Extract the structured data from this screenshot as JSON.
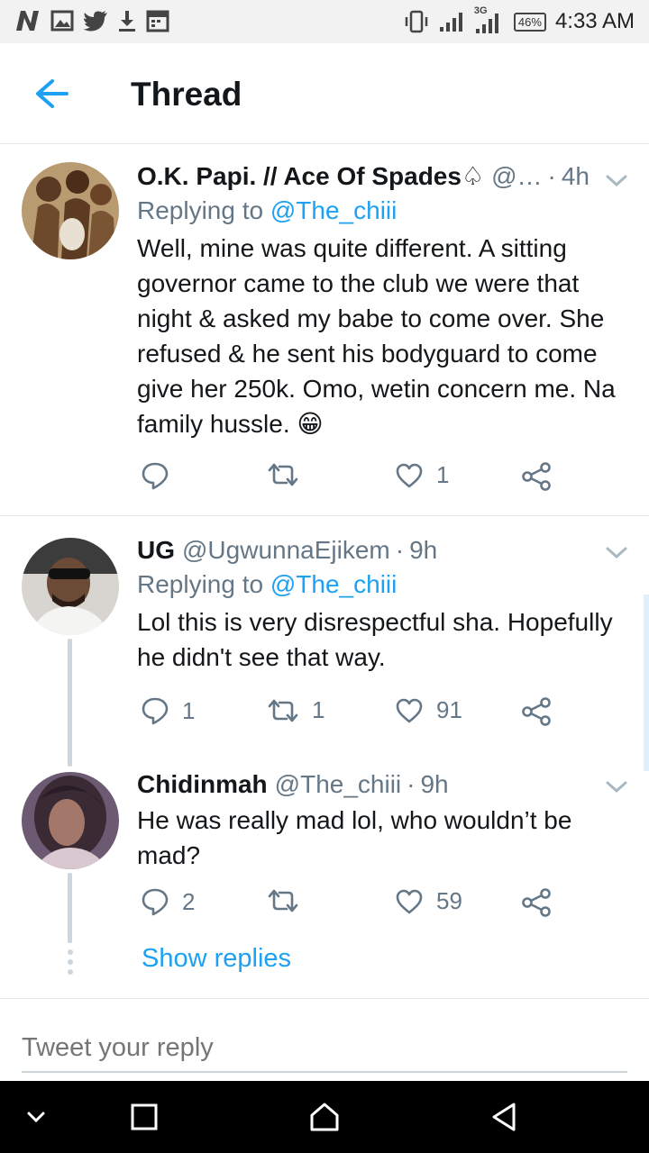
{
  "status_bar": {
    "time": "4:33 AM",
    "battery": "46%",
    "network": "3G"
  },
  "app_bar": {
    "title": "Thread",
    "back_icon": "arrow-left-icon"
  },
  "tweets": [
    {
      "name": "O.K. Papi. // Ace Of Spades♤",
      "handle": "@…",
      "time": "4h",
      "replying_prefix": "Replying to ",
      "replying_to": "@The_chiii",
      "text": "Well, mine was quite different. A sitting governor came to the club we were that night & asked my babe to come over. She refused & he sent his bodyguard to come give her 250k. Omo, wetin concern me. Na family hussle.",
      "emoji": "😁",
      "replies": "",
      "retweets": "",
      "likes": "1"
    },
    {
      "name": "UG",
      "handle": "@UgwunnaEjikem",
      "time": "9h",
      "replying_prefix": "Replying to ",
      "replying_to": "@The_chiii",
      "text": "Lol this is very disrespectful sha. Hopefully he didn't see that way.",
      "replies": "1",
      "retweets": "1",
      "likes": "91"
    },
    {
      "name": "Chidinmah",
      "handle": "@The_chiii",
      "time": "9h",
      "text": "He was really mad lol, who wouldn’t be mad?",
      "replies": "2",
      "retweets": "",
      "likes": "59"
    }
  ],
  "show_replies": "Show replies",
  "composer": {
    "placeholder": "Tweet your reply"
  },
  "colors": {
    "accent": "#1da1f2",
    "secondary_text": "#657786",
    "divider": "#e1e8ed"
  }
}
